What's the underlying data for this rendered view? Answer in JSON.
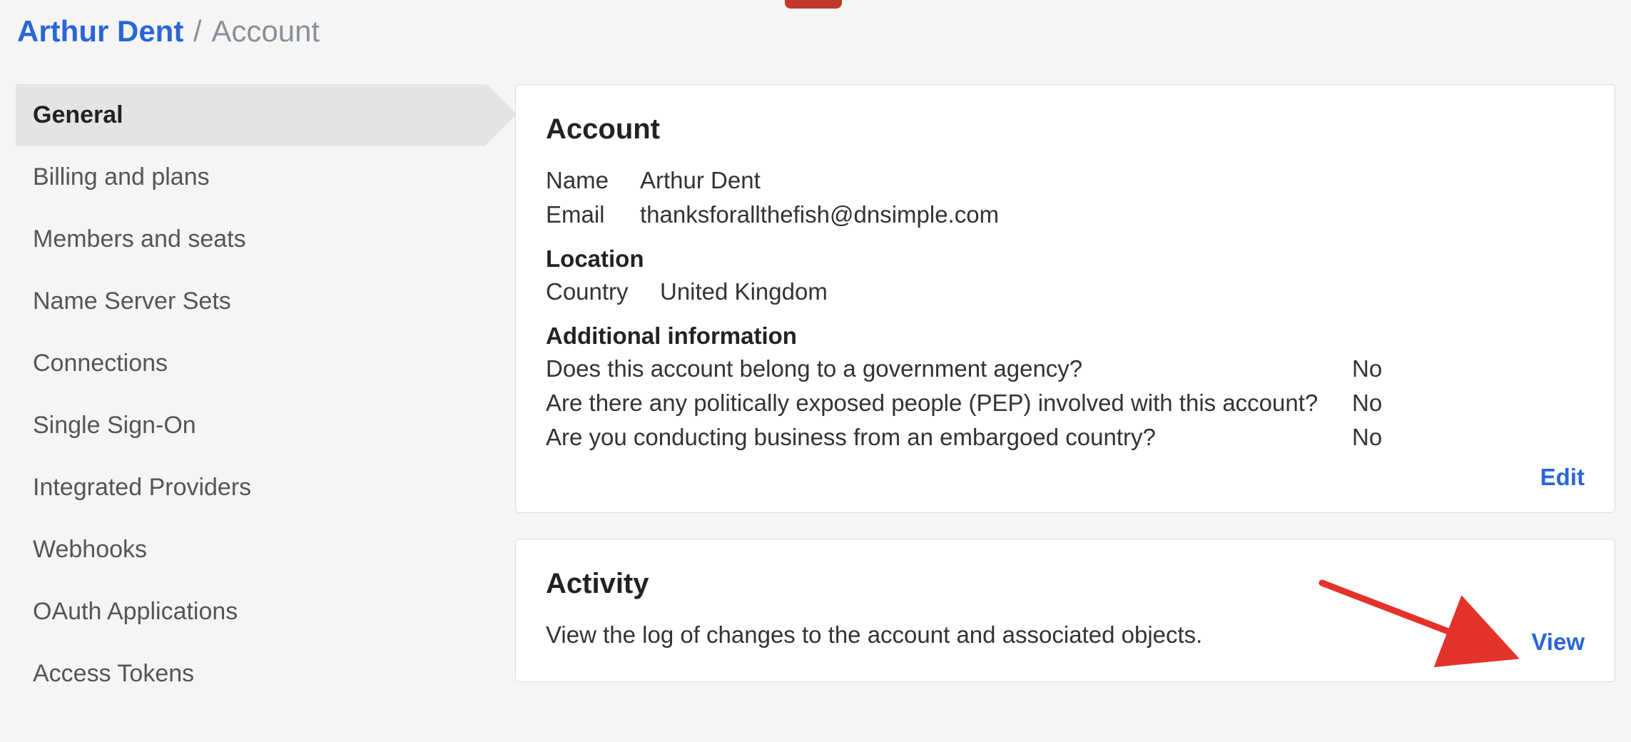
{
  "breadcrumb": {
    "primary": "Arthur Dent",
    "separator": "/",
    "secondary": "Account"
  },
  "sidebar": {
    "items": [
      {
        "label": "General",
        "active": true
      },
      {
        "label": "Billing and plans",
        "active": false
      },
      {
        "label": "Members and seats",
        "active": false
      },
      {
        "label": "Name Server Sets",
        "active": false
      },
      {
        "label": "Connections",
        "active": false
      },
      {
        "label": "Single Sign-On",
        "active": false
      },
      {
        "label": "Integrated Providers",
        "active": false
      },
      {
        "label": "Webhooks",
        "active": false
      },
      {
        "label": "OAuth Applications",
        "active": false
      },
      {
        "label": "Access Tokens",
        "active": false
      }
    ]
  },
  "account_card": {
    "title": "Account",
    "name_label": "Name",
    "name_value": "Arthur Dent",
    "email_label": "Email",
    "email_value": "thanksforallthefish@dnsimple.com",
    "location_heading": "Location",
    "country_label": "Country",
    "country_value": "United Kingdom",
    "additional_heading": "Additional information",
    "questions": [
      {
        "q": "Does this account belong to a government agency?",
        "a": "No"
      },
      {
        "q": "Are there any politically exposed people (PEP) involved with this account?",
        "a": "No"
      },
      {
        "q": "Are you conducting business from an embargoed country?",
        "a": "No"
      }
    ],
    "edit_link": "Edit"
  },
  "activity_card": {
    "title": "Activity",
    "description": "View the log of changes to the account and associated objects.",
    "view_link": "View"
  }
}
